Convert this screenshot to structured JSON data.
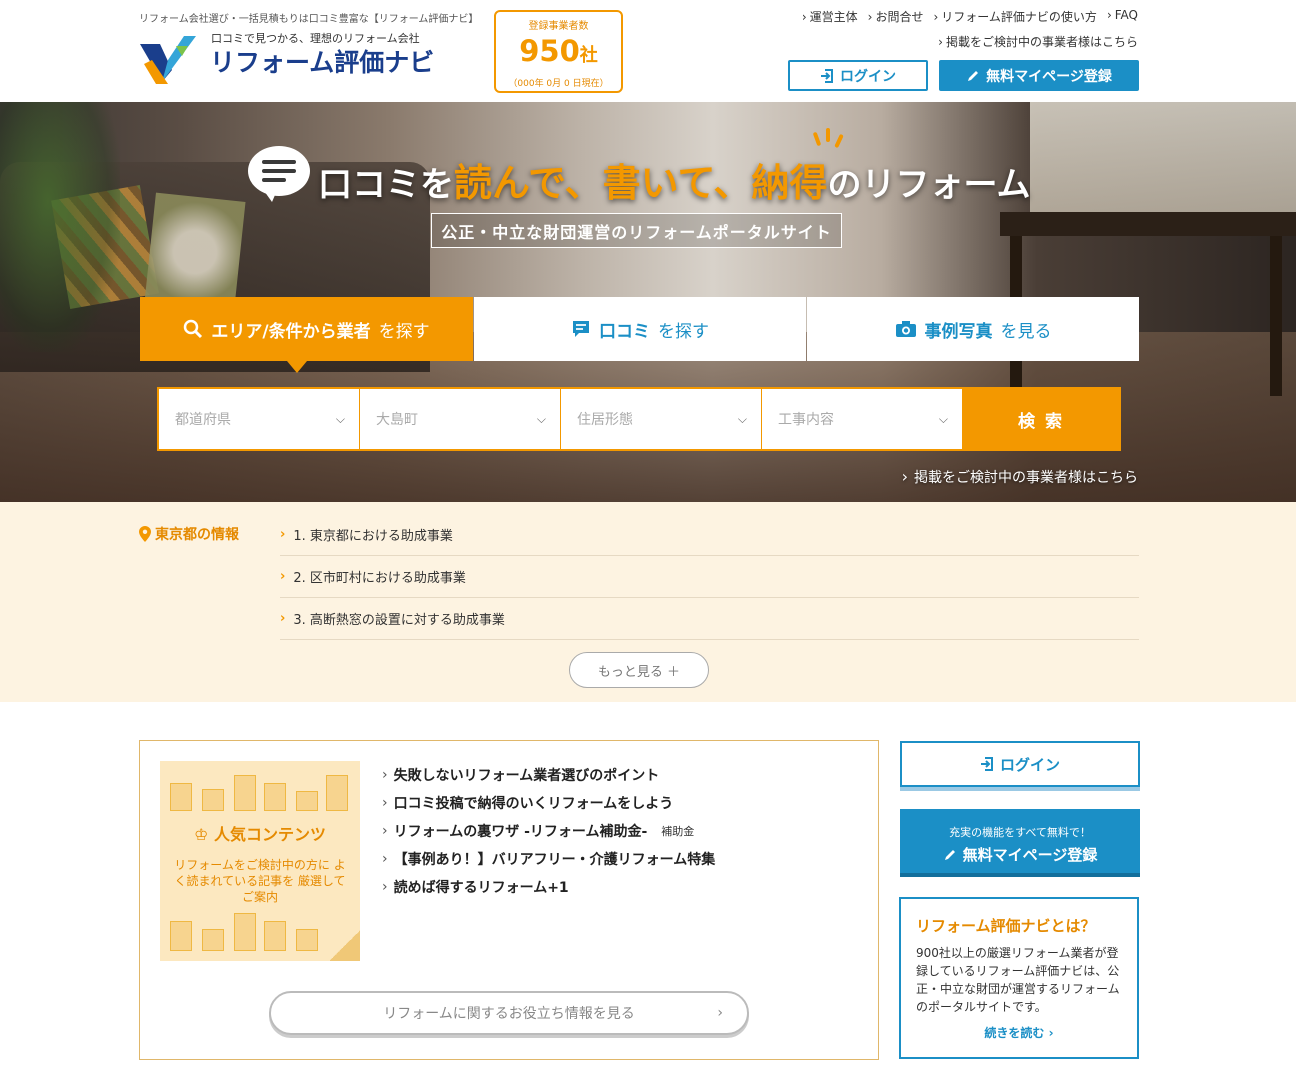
{
  "header": {
    "tagline": "リフォーム会社選び・一括見積もりは口コミ豊富な【リフォーム評価ナビ】",
    "logo_sub": "口コミで見つかる、理想のリフォーム会社",
    "logo_main": "リフォーム評価ナビ",
    "count_label": "登録事業者数",
    "count_value": "950",
    "count_unit": "社",
    "count_date": "（000年 0月 0 日現在）",
    "top_links": [
      "運営主体",
      "お問合せ",
      "リフォーム評価ナビの使い方",
      "FAQ"
    ],
    "sub_link": "掲載をご検討中の事業者様はこちら",
    "login_label": "ログイン",
    "register_label": "無料マイページ登録"
  },
  "hero": {
    "headline_pre": "口コミを",
    "headline_hl": "読んで、書いて、納得",
    "headline_post": "のリフォーム",
    "subhead": "公正・中立な財団運営のリフォームポータルサイト",
    "tabs": [
      {
        "strong": "エリア/条件から業者",
        "thin": "を探す",
        "icon": "search-icon"
      },
      {
        "strong": "口コミ",
        "thin": "を探す",
        "icon": "comment-icon"
      },
      {
        "strong": "事例写真",
        "thin": "を見る",
        "icon": "camera-icon"
      }
    ],
    "selects": [
      "都道府県",
      "大島町",
      "住居形態",
      "工事内容"
    ],
    "search_button": "検 索",
    "bottom_link": "掲載をご検討中の事業者様はこちら"
  },
  "info": {
    "title": "東京都の情報",
    "items": [
      "1. 東京都における助成事業",
      "2. 区市町村における助成事業",
      "3. 高断熱窓の設置に対する助成事業"
    ],
    "more": "もっと見る ＋"
  },
  "popular": {
    "title": "人気コンテンツ",
    "desc": "リフォームをご検討中の方に よく読まれている記事を 厳選してご案内",
    "links": [
      {
        "text": "失敗しないリフォーム業者選びのポイント",
        "tag": ""
      },
      {
        "text": "口コミ投稿で納得のいくリフォームをしよう",
        "tag": ""
      },
      {
        "text": "リフォームの裏ワザ -リフォーム補助金-",
        "tag": "補助金"
      },
      {
        "text": "【事例あり！】バリアフリー・介護リフォーム特集",
        "tag": ""
      },
      {
        "text": "読めば得するリフォーム+1",
        "tag": ""
      }
    ],
    "more": "リフォームに関するお役立ち情報を見る"
  },
  "sidebar": {
    "login": "ログイン",
    "reg_small": "充実の機能をすべて無料で！",
    "reg_big": "無料マイページ登録",
    "about_title": "リフォーム評価ナビとは？",
    "about_text": "900社以上の厳選リフォーム業者が登録しているリフォーム評価ナビは、公正・中立な財団が運営するリフォームのポータルサイトです。",
    "about_more": "続きを読む"
  },
  "colors": {
    "accent_orange": "#f39800",
    "accent_blue": "#1b8fc6",
    "info_bg": "#fdf3e1"
  }
}
